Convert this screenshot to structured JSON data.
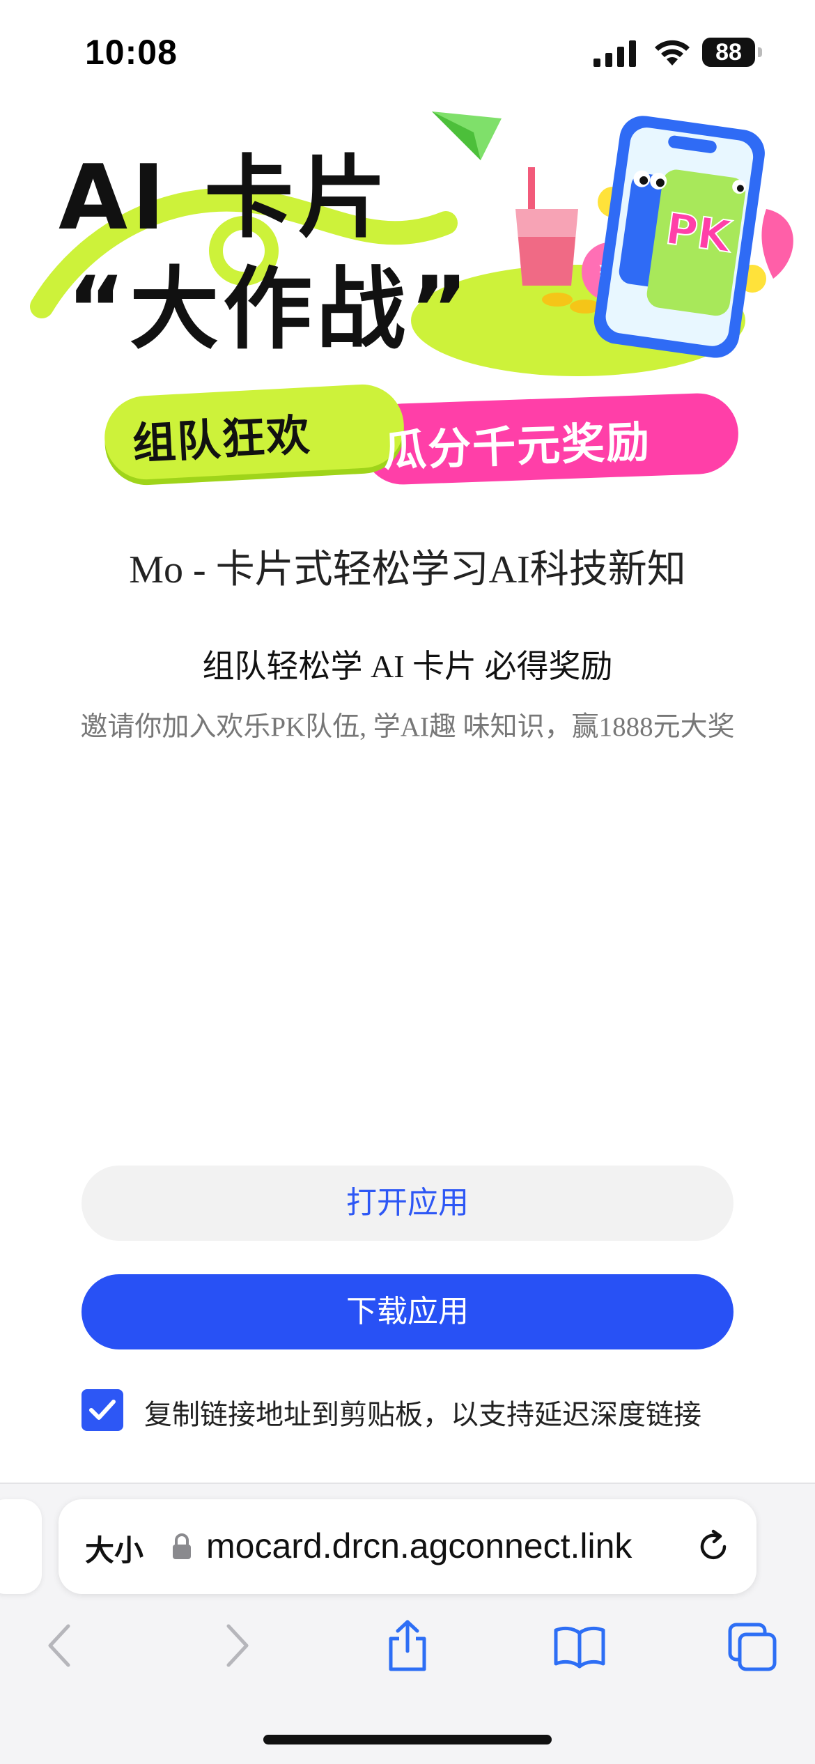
{
  "status_bar": {
    "time": "10:08",
    "battery": "88",
    "icons": [
      "signal-icon",
      "wifi-icon",
      "battery-icon"
    ]
  },
  "banner": {
    "title_line1": "AI 卡片",
    "title_line2": "“大作战”",
    "pill_left": "组队狂欢",
    "pill_right": "瓜分千元奖励",
    "badge": "PK",
    "colors": {
      "green": "#cdf23a",
      "pink": "#ff3fa8",
      "blue": "#2f6bf5"
    }
  },
  "app_title": "Mo - 卡片式轻松学习AI科技新知",
  "subtitle": "组队轻松学 AI 卡片 必得奖励",
  "description": "邀请你加入欢乐PK队伍, 学AI趣 味知识，赢1888元大奖",
  "buttons": {
    "open": "打开应用",
    "download": "下载应用"
  },
  "copy_option": {
    "checked": true,
    "label": "复制链接地址到剪贴板，以支持延迟深度链接"
  },
  "browser": {
    "text_size_label": "大小",
    "url": "mocard.drcn.agconnect.link",
    "nav_icons": [
      "back-icon",
      "forward-icon",
      "share-icon",
      "bookmarks-icon",
      "tabs-icon"
    ]
  },
  "colors": {
    "accent": "#2851f5",
    "open_button_bg": "#f2f2f2"
  }
}
